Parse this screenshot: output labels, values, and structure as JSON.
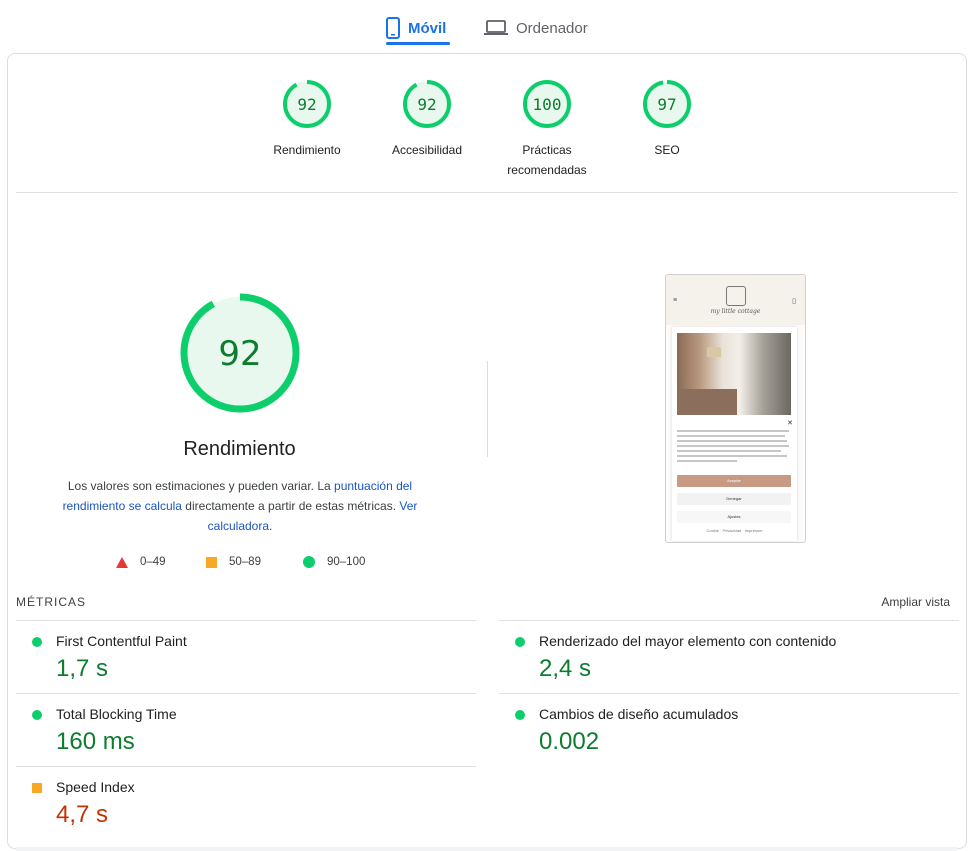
{
  "tabs": [
    {
      "label": "Móvil",
      "active": true,
      "icon": "mobile-icon"
    },
    {
      "label": "Ordenador",
      "active": false,
      "icon": "laptop-icon"
    }
  ],
  "scores": [
    {
      "value": "92",
      "label": "Rendimiento",
      "fraction": 0.92
    },
    {
      "value": "92",
      "label": "Accesibilidad",
      "fraction": 0.92
    },
    {
      "value": "100",
      "label": "Prácticas recomendadas",
      "fraction": 1.0
    },
    {
      "value": "97",
      "label": "SEO",
      "fraction": 0.97
    }
  ],
  "performance": {
    "value": "92",
    "fraction": 0.92,
    "title": "Rendimiento",
    "desc_part1": "Los valores son estimaciones y pueden variar. La ",
    "desc_link1": "puntuación del rendimiento se calcula",
    "desc_part2": " directamente a partir de estas métricas. ",
    "desc_link2": "Ver calculadora",
    "desc_part3": "."
  },
  "legend": [
    {
      "shape": "triangle",
      "label": "0–49",
      "color": "#e53935"
    },
    {
      "shape": "square",
      "label": "50–89",
      "color": "#f9a825"
    },
    {
      "shape": "circle",
      "label": "90–100",
      "color": "#0cce6b"
    }
  ],
  "phone_preview": {
    "brand": "my little cottage",
    "accept": "Aceptar",
    "deny": "Denegar",
    "preferences": "Ajustes",
    "footer": "Cookie · Privacidad · Impresum"
  },
  "metrics": {
    "title": "MÉTRICAS",
    "expand_label": "Ampliar vista",
    "items": [
      {
        "name": "First Contentful Paint",
        "value": "1,7 s",
        "status": "good"
      },
      {
        "name": "Renderizado del mayor elemento con contenido",
        "value": "2,4 s",
        "status": "good"
      },
      {
        "name": "Total Blocking Time",
        "value": "160 ms",
        "status": "good"
      },
      {
        "name": "Cambios de diseño acumulados",
        "value": "0.002",
        "status": "good"
      },
      {
        "name": "Speed Index",
        "value": "4,7 s",
        "status": "average"
      }
    ]
  },
  "colors": {
    "accent": "#1a73e8",
    "good": "#0cce6b",
    "good_text": "#0c7d2e",
    "average": "#f9a825",
    "average_text": "#c33300",
    "gauge_bg": "#e8f8ee"
  }
}
